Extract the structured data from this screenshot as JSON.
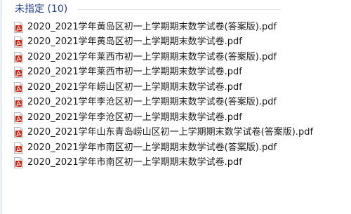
{
  "group": {
    "title": "未指定 (10)"
  },
  "files": [
    {
      "name": "2020_2021学年黄岛区初一上学期期末数学试卷(答案版).pdf",
      "icon": "pdf-file-icon"
    },
    {
      "name": "2020_2021学年黄岛区初一上学期期末数学试卷.pdf",
      "icon": "pdf-file-icon"
    },
    {
      "name": "2020_2021学年莱西市初一上学期期末数学试卷(答案版).pdf",
      "icon": "pdf-file-icon"
    },
    {
      "name": "2020_2021学年莱西市初一上学期期末数学试卷.pdf",
      "icon": "pdf-file-icon"
    },
    {
      "name": "2020_2021学年崂山区初一上学期期末数学试卷.pdf",
      "icon": "pdf-file-icon"
    },
    {
      "name": "2020_2021学年李沧区初一上学期期末数学试卷(答案版).pdf",
      "icon": "pdf-file-icon"
    },
    {
      "name": "2020_2021学年李沧区初一上学期期末数学试卷.pdf",
      "icon": "pdf-file-icon"
    },
    {
      "name": "2020_2021学年山东青岛崂山区初一上学期期末数学试卷(答案版).pdf",
      "icon": "pdf-file-icon"
    },
    {
      "name": "2020_2021学年市南区初一上学期期末数学试卷(答案版).pdf",
      "icon": "pdf-file-icon"
    },
    {
      "name": "2020_2021学年市南区初一上学期期末数学试卷.pdf",
      "icon": "pdf-file-icon"
    }
  ],
  "colors": {
    "group_title": "#1e3f98",
    "pdf_red": "#d81e06"
  }
}
